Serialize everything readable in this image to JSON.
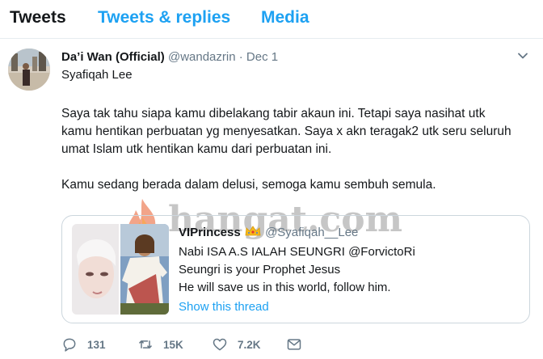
{
  "tabs": [
    {
      "label": "Tweets",
      "active": true
    },
    {
      "label": "Tweets & replies",
      "active": false
    },
    {
      "label": "Media",
      "active": false
    }
  ],
  "tweet": {
    "author_name": "Da’i Wan (Official)",
    "author_handle": "@wandazrin",
    "separator": "·",
    "date": "Dec 1",
    "reply_to_line": "Syafiqah Lee",
    "paragraph1": "Saya tak tahu siapa kamu dibelakang tabir akaun ini. Tetapi saya nasihat utk kamu hentikan perbuatan yg menyesatkan. Saya x akn teragak2 utk seru seluruh umat Islam utk hentikan kamu dari perbuatan ini.",
    "paragraph2": "Kamu sedang berada dalam delusi, semoga kamu sembuh semula.",
    "watermark": "hangat.com"
  },
  "quoted": {
    "name": "VIPrincess",
    "handle": "@Syafiqah__Lee",
    "lines": [
      "Nabi ISA A.S IALAH SEUNGRI @ForvictoRi",
      "Seungri is your Prophet Jesus",
      "He will save us in this world, follow him."
    ],
    "show_thread": "Show this thread"
  },
  "actions": {
    "replies": "131",
    "retweets": "15K",
    "likes": "7.2K"
  },
  "colors": {
    "link_blue": "#1da1f2",
    "muted_gray": "#657786",
    "text_dark": "#14171a",
    "border": "#ccd6dd"
  },
  "icons": [
    "chevron-down-icon",
    "crown-icon",
    "reply-icon",
    "retweet-icon",
    "like-icon",
    "dm-icon",
    "flame-icon"
  ]
}
